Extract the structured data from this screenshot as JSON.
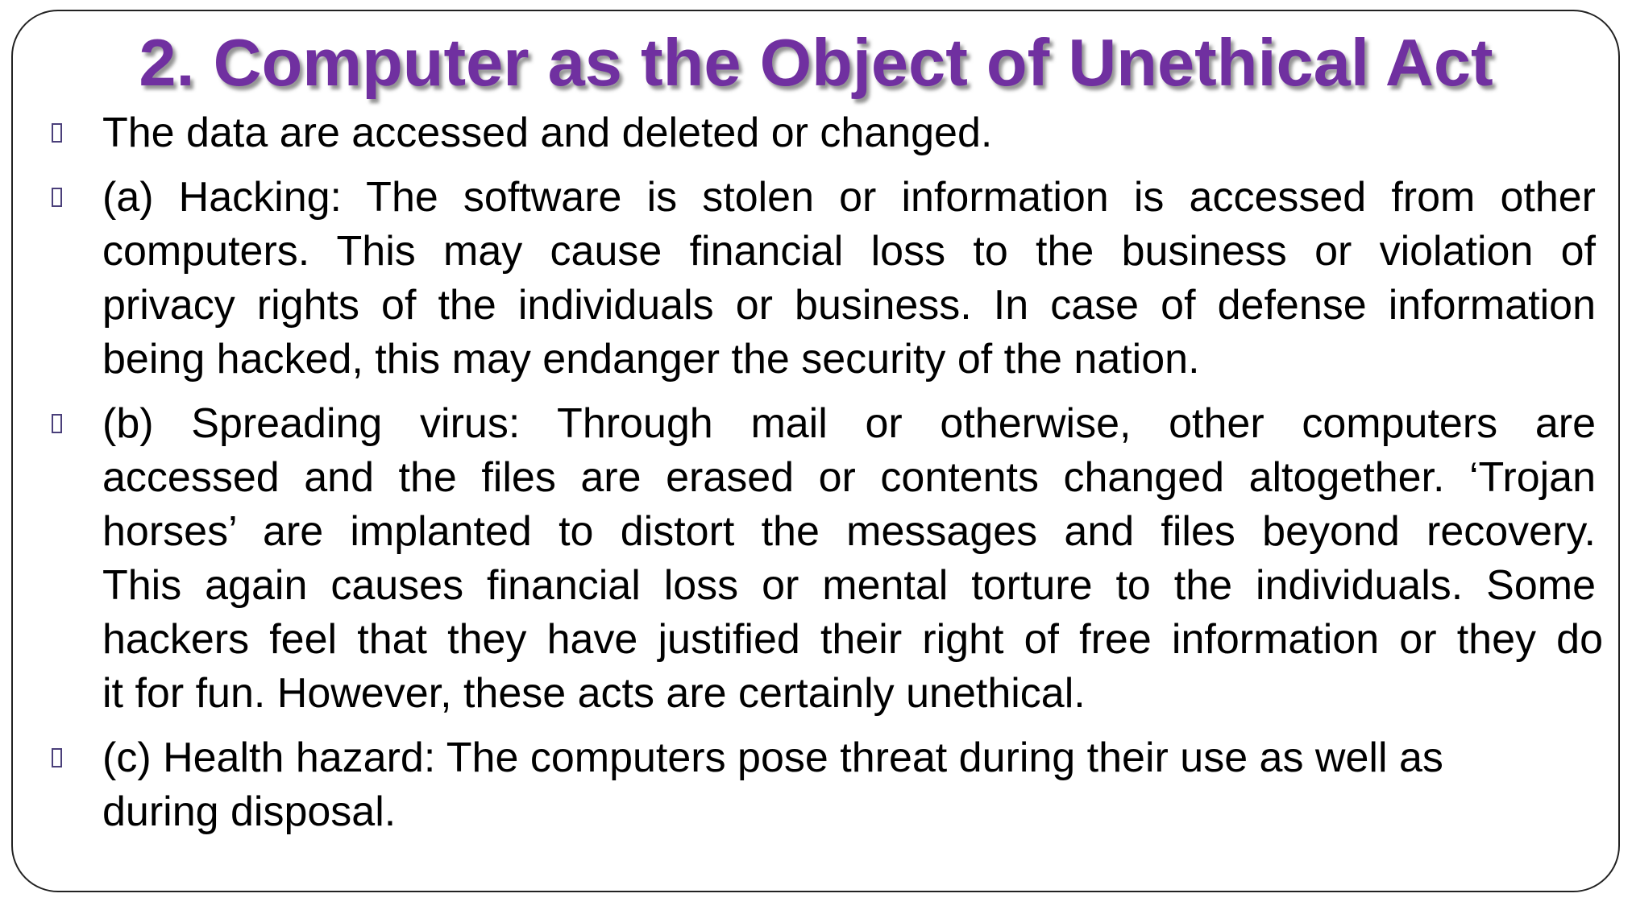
{
  "slide": {
    "title": "2. Computer as the Object of Unethical Act",
    "bullet_color": "#4a3f7a",
    "title_color": "#7030a0",
    "items": [
      {
        "lines": [
          "The data are accessed and deleted or changed."
        ]
      },
      {
        "lines": [
          "(a) Hacking: The software is stolen or information is accessed from other",
          "computers. This may cause financial loss to the business or violation of",
          "privacy rights of the individuals or business. In case of defense information",
          "being hacked, this may endanger the security of the nation."
        ]
      },
      {
        "lines": [
          "(b) Spreading virus: Through mail or otherwise, other computers are",
          "accessed and the files are erased or contents changed altogether. ‘Trojan",
          "horses’ are implanted to distort the messages and files beyond recovery.",
          "This again causes financial loss or mental torture to the individuals. Some",
          "hackers feel that they have justified their right of free information or they do",
          "it for fun. However, these acts are certainly unethical."
        ]
      },
      {
        "lines": [
          "(c) Health hazard: The computers pose threat during their use as well as",
          "during disposal."
        ]
      }
    ]
  }
}
